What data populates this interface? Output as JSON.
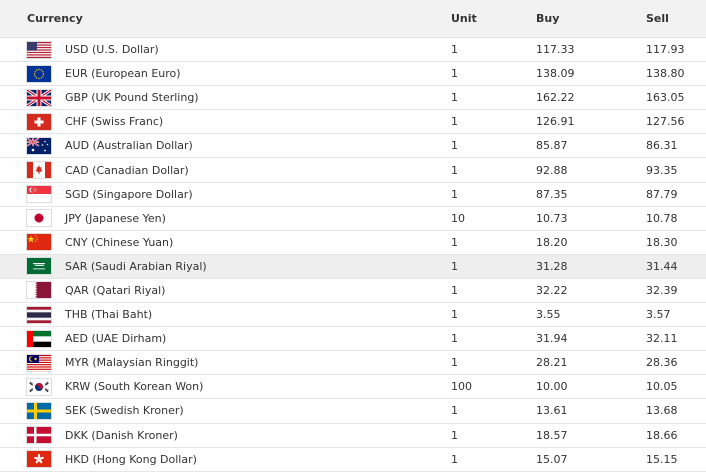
{
  "columns": {
    "currency": "Currency",
    "unit": "Unit",
    "buy": "Buy",
    "sell": "Sell"
  },
  "rows": [
    {
      "code": "usd",
      "label": "USD (U.S. Dollar)",
      "unit": "1",
      "buy": "117.33",
      "sell": "117.93"
    },
    {
      "code": "eur",
      "label": "EUR (European Euro)",
      "unit": "1",
      "buy": "138.09",
      "sell": "138.80"
    },
    {
      "code": "gbp",
      "label": "GBP (UK Pound Sterling)",
      "unit": "1",
      "buy": "162.22",
      "sell": "163.05"
    },
    {
      "code": "chf",
      "label": "CHF (Swiss Franc)",
      "unit": "1",
      "buy": "126.91",
      "sell": "127.56"
    },
    {
      "code": "aud",
      "label": "AUD (Australian Dollar)",
      "unit": "1",
      "buy": "85.87",
      "sell": "86.31"
    },
    {
      "code": "cad",
      "label": "CAD (Canadian Dollar)",
      "unit": "1",
      "buy": "92.88",
      "sell": "93.35"
    },
    {
      "code": "sgd",
      "label": "SGD (Singapore Dollar)",
      "unit": "1",
      "buy": "87.35",
      "sell": "87.79"
    },
    {
      "code": "jpy",
      "label": "JPY (Japanese Yen)",
      "unit": "10",
      "buy": "10.73",
      "sell": "10.78"
    },
    {
      "code": "cny",
      "label": "CNY (Chinese Yuan)",
      "unit": "1",
      "buy": "18.20",
      "sell": "18.30"
    },
    {
      "code": "sar",
      "label": "SAR (Saudi Arabian Riyal)",
      "unit": "1",
      "buy": "31.28",
      "sell": "31.44"
    },
    {
      "code": "qar",
      "label": "QAR (Qatari Riyal)",
      "unit": "1",
      "buy": "32.22",
      "sell": "32.39"
    },
    {
      "code": "thb",
      "label": "THB (Thai Baht)",
      "unit": "1",
      "buy": "3.55",
      "sell": "3.57"
    },
    {
      "code": "aed",
      "label": "AED (UAE Dirham)",
      "unit": "1",
      "buy": "31.94",
      "sell": "32.11"
    },
    {
      "code": "myr",
      "label": "MYR (Malaysian Ringgit)",
      "unit": "1",
      "buy": "28.21",
      "sell": "28.36"
    },
    {
      "code": "krw",
      "label": "KRW (South Korean Won)",
      "unit": "100",
      "buy": "10.00",
      "sell": "10.05"
    },
    {
      "code": "sek",
      "label": "SEK (Swedish Kroner)",
      "unit": "1",
      "buy": "13.61",
      "sell": "13.68"
    },
    {
      "code": "dkk",
      "label": "DKK (Danish Kroner)",
      "unit": "1",
      "buy": "18.57",
      "sell": "18.66"
    },
    {
      "code": "hkd",
      "label": "HKD (Hong Kong Dollar)",
      "unit": "1",
      "buy": "15.07",
      "sell": "15.15"
    }
  ],
  "highlighted_row": "sar"
}
